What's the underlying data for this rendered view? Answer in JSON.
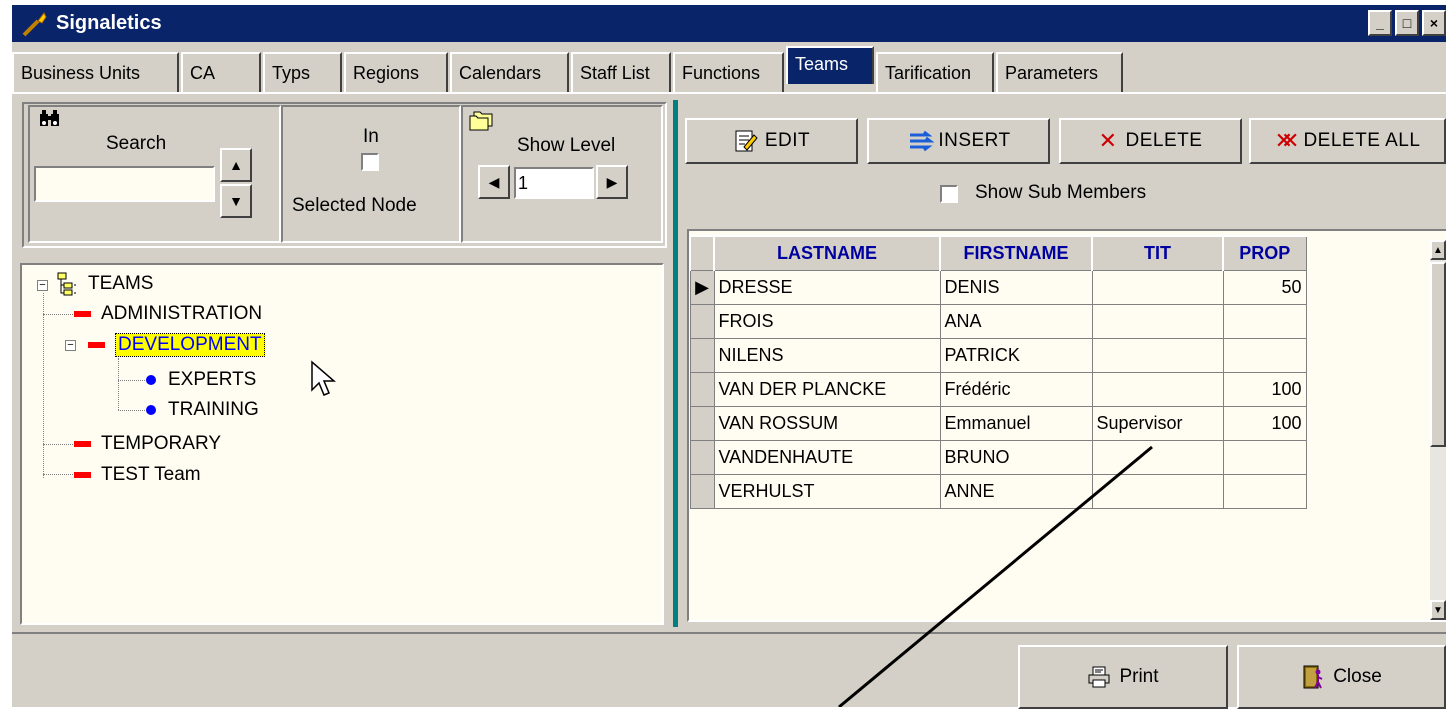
{
  "window": {
    "title": "Signaletics",
    "controls": [
      "_",
      "□",
      "×"
    ]
  },
  "tabs": [
    {
      "label": "Business Units",
      "active": false
    },
    {
      "label": "CA",
      "active": false
    },
    {
      "label": "Typs",
      "active": false
    },
    {
      "label": "Regions",
      "active": false
    },
    {
      "label": "Calendars",
      "active": false
    },
    {
      "label": "Staff List",
      "active": false
    },
    {
      "label": "Functions",
      "active": false
    },
    {
      "label": "Teams",
      "active": true
    },
    {
      "label": "Tarification",
      "active": false
    },
    {
      "label": "Parameters",
      "active": false
    }
  ],
  "search": {
    "label": "Search",
    "value": "",
    "icon": "binoculars-icon"
  },
  "selected_node_filter": {
    "label_top": "In",
    "label_bottom": "Selected Node",
    "checked": false
  },
  "show_level": {
    "label": "Show Level",
    "value": "1",
    "icon": "folders-icon"
  },
  "tree": {
    "root": "TEAMS",
    "nodes": [
      "ADMINISTRATION",
      "DEVELOPMENT",
      "EXPERTS",
      "TRAINING",
      "TEMPORARY",
      "TEST Team"
    ],
    "selected": "DEVELOPMENT"
  },
  "actions": {
    "edit": "EDIT",
    "insert": "INSERT",
    "delete": "DELETE",
    "delete_all": "DELETE ALL"
  },
  "show_sub_members": {
    "label": "Show Sub Members",
    "checked": false
  },
  "grid": {
    "columns": [
      "LASTNAME",
      "FIRSTNAME",
      "TIT",
      "PROP"
    ],
    "rows": [
      {
        "lastname": "DRESSE",
        "firstname": "DENIS",
        "tit": "",
        "prop": "50",
        "current": true
      },
      {
        "lastname": "FROIS",
        "firstname": "ANA",
        "tit": "",
        "prop": ""
      },
      {
        "lastname": "NILENS",
        "firstname": "PATRICK",
        "tit": "",
        "prop": ""
      },
      {
        "lastname": "VAN DER PLANCKE",
        "firstname": "Frédéric",
        "tit": "",
        "prop": "100"
      },
      {
        "lastname": "VAN ROSSUM",
        "firstname": "Emmanuel",
        "tit": "Supervisor",
        "prop": "100"
      },
      {
        "lastname": "VANDENHAUTE",
        "firstname": "BRUNO",
        "tit": "",
        "prop": ""
      },
      {
        "lastname": "VERHULST",
        "firstname": "ANNE",
        "tit": "",
        "prop": ""
      }
    ]
  },
  "footer": {
    "print": "Print",
    "close": "Close"
  },
  "colors": {
    "titlebar": "#0a246a",
    "face": "#d4d0c8",
    "grid_header": "#0000a0",
    "tree_dash": "#ff0000",
    "tree_dot": "#0000ff",
    "selection": "#ffff00",
    "splitter": "#008080"
  }
}
